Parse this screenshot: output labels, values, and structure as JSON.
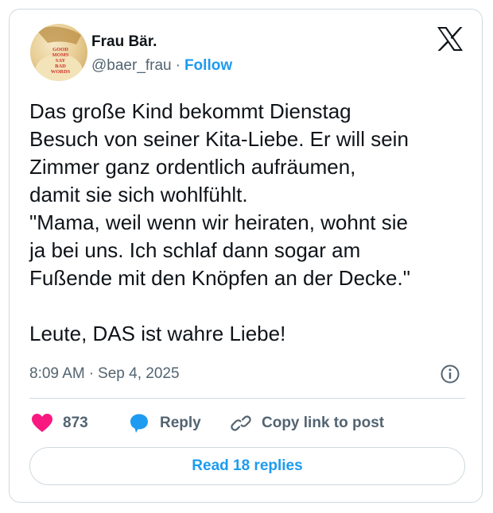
{
  "author": {
    "name": "Frau Bär.",
    "handle": "@baer_frau",
    "separator": "·",
    "follow_label": "Follow",
    "avatar_shirt_text": "GOOD MOMS SAY BAD WORDS"
  },
  "brand": {
    "icon": "x-logo-icon"
  },
  "tweet": {
    "text": "Das große Kind bekommt Dienstag\nBesuch von seiner Kita-Liebe. Er will sein\nZimmer ganz ordentlich aufräumen,\ndamit sie sich wohlfühlt.\n\"Mama, weil wenn wir heiraten, wohnt sie\nja bei uns. Ich schlaf dann sogar am\nFußende mit den Knöpfen an der Decke.\"\n\nLeute, DAS ist wahre Liebe!",
    "time": "8:09 AM",
    "separator": "·",
    "date": "Sep 4, 2025"
  },
  "actions": {
    "like_count": "873",
    "reply_label": "Reply",
    "copy_label": "Copy link to post"
  },
  "footer": {
    "read_replies_label": "Read 18 replies"
  },
  "colors": {
    "accent": "#1d9bf0",
    "like": "#f91880",
    "muted": "#536471",
    "text": "#0f1419",
    "border": "#cfd9de"
  },
  "icons": {
    "info": "info-circle-icon",
    "like": "heart-icon",
    "reply": "speech-bubble-icon",
    "copy": "link-icon"
  }
}
